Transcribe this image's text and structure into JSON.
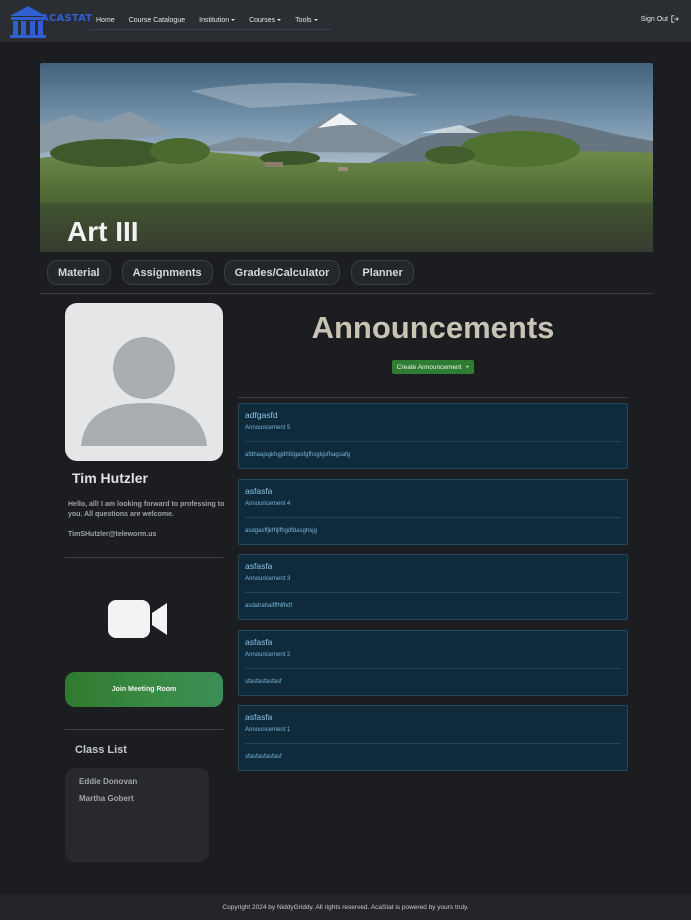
{
  "brand": {
    "name": "ACASTAT"
  },
  "nav": {
    "items": [
      {
        "label": "Home",
        "dropdown": false
      },
      {
        "label": "Course Catalogue",
        "dropdown": false
      },
      {
        "label": "Institution",
        "dropdown": true
      },
      {
        "label": "Courses",
        "dropdown": true
      },
      {
        "label": "Tools",
        "dropdown": true
      }
    ],
    "signout_label": "Sign Out"
  },
  "course": {
    "title": "Art III"
  },
  "tabs": [
    "Material",
    "Assignments",
    "Grades/Calculator",
    "Planner"
  ],
  "profile": {
    "name": "Tim Hutzler",
    "bio": "Hello, all! I am looking forward to professing to you. All questions are welcome.",
    "email": "TimSHutzler@teleworm.us"
  },
  "meeting": {
    "join_label": "Join Meeting Room"
  },
  "class_list": {
    "title": "Class List",
    "students": [
      "Eddie Donovan",
      "Martha Gobert"
    ]
  },
  "announcements": {
    "title": "Announcements",
    "create_label": "Create Announcement",
    "items": [
      {
        "title": "adfgasfd",
        "subtitle": "Announcement 5",
        "body": "afdhaajsgkhgjdhfdgasfgfhsgkjsfhagsafg"
      },
      {
        "title": "asfasfa",
        "subtitle": "Announcement 4",
        "body": "asdgasffjkfhjlfhgdfdasghsjg"
      },
      {
        "title": "asfasfa",
        "subtitle": "Announcement 3",
        "body": "asdahahaifffhlfhdf"
      },
      {
        "title": "asfasfa",
        "subtitle": "Announcement 2",
        "body": "sfasfasfasfasf"
      },
      {
        "title": "asfasfa",
        "subtitle": "Announcement 1",
        "body": "sfasfasfasfasf"
      }
    ]
  },
  "footer": {
    "text": "Copyright 2024 by NiddyGriddy. All rights reserved. AcaStat is powered by yours truly."
  },
  "colors": {
    "background": "#1b1d20",
    "navbar": "#2a2d31",
    "brand": "#2f5fd0",
    "announcement_card": "#0f2b3b",
    "announcement_text": "#8ec3e6",
    "create_button": "#2f7d33",
    "join_button": "#3a8a44"
  },
  "icons": {
    "logo": "pillar-building-icon",
    "signout": "sign-out-icon",
    "create": "plus-icon",
    "camera": "video-camera-icon",
    "avatar": "person-silhouette-icon"
  }
}
